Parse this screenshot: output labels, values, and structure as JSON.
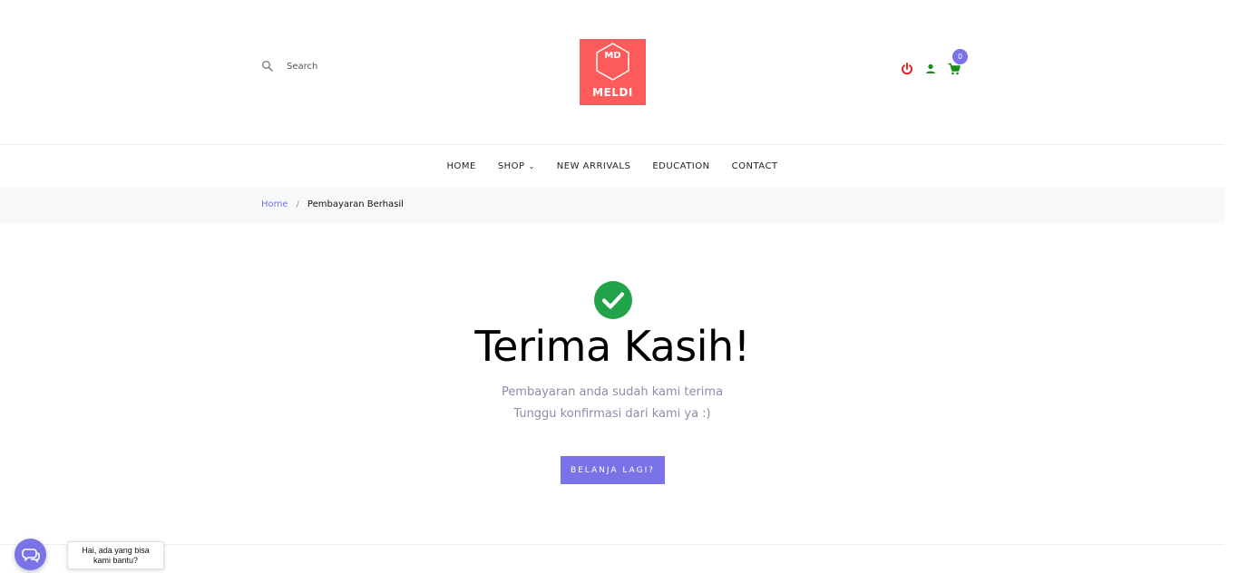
{
  "header": {
    "search": {
      "placeholder": "Search",
      "icon": "search-icon"
    },
    "logo": {
      "monogram": "MD",
      "name": "MELDI",
      "color": "#fe5c5c"
    },
    "icons": [
      {
        "name": "power-icon",
        "color": "#e02020"
      },
      {
        "name": "user-icon",
        "color": "#1a8a1a"
      },
      {
        "name": "cart-icon",
        "color": "#1a8a1a"
      }
    ],
    "cart_count": "0"
  },
  "nav": {
    "items": [
      {
        "label": "HOME"
      },
      {
        "label": "SHOP",
        "has_dropdown": true
      },
      {
        "label": "NEW ARRIVALS"
      },
      {
        "label": "EDUCATION"
      },
      {
        "label": "CONTACT"
      }
    ]
  },
  "breadcrumb": {
    "home": "Home",
    "separator": "/",
    "current": "Pembayaran Berhasil"
  },
  "main": {
    "icon": "check-circle-icon",
    "title": "Terima Kasih!",
    "message_line1": "Pembayaran anda sudah kami terima",
    "message_line2": "Tunggu konfirmasi dari kami ya :)",
    "button_label": "BELANJA LAGI?"
  },
  "chat": {
    "line1": "Hai, ada yang bisa",
    "line2": "kami bantu?"
  },
  "colors": {
    "accent": "#7a73e8",
    "success": "#21a34a",
    "muted_text": "#8a8fa3",
    "breadcrumb_bg": "#f7f8fa"
  }
}
